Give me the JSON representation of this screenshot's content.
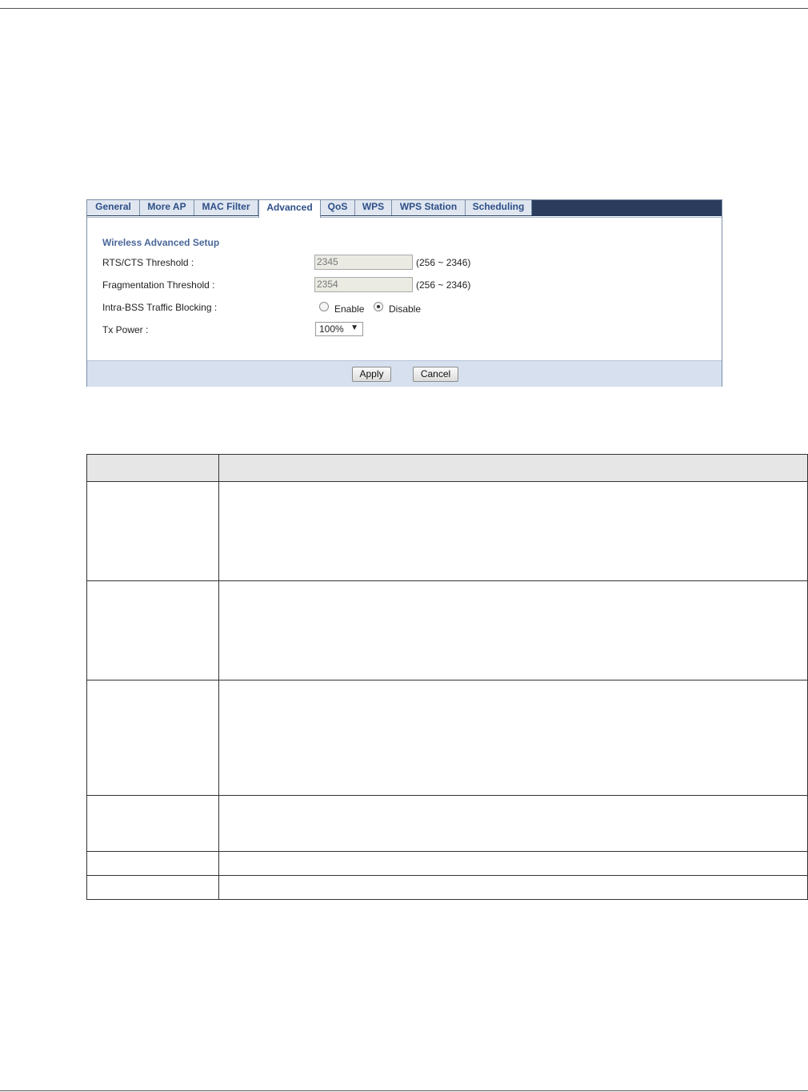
{
  "tabs": [
    {
      "label": "General",
      "active": false
    },
    {
      "label": "More AP",
      "active": false
    },
    {
      "label": "MAC Filter",
      "active": false
    },
    {
      "label": "Advanced",
      "active": true
    },
    {
      "label": "QoS",
      "active": false
    },
    {
      "label": "WPS",
      "active": false
    },
    {
      "label": "WPS Station",
      "active": false
    },
    {
      "label": "Scheduling",
      "active": false
    }
  ],
  "section_title": "Wireless Advanced Setup",
  "rts": {
    "label": "RTS/CTS Threshold :",
    "value": "2345",
    "range": "(256 ~ 2346)"
  },
  "frag": {
    "label": "Fragmentation Threshold :",
    "value": "2354",
    "range": "(256 ~ 2346)"
  },
  "intra": {
    "label": "Intra-BSS Traffic Blocking :",
    "enable": "Enable",
    "disable": "Disable",
    "selected": "Disable"
  },
  "txpower": {
    "label": "Tx Power :",
    "value": "100%"
  },
  "buttons": {
    "apply": "Apply",
    "cancel": "Cancel"
  },
  "colors": {
    "tab_text": "#2e4f88",
    "tabbar": "#2b3c5c",
    "footer": "#d6e0ee"
  }
}
